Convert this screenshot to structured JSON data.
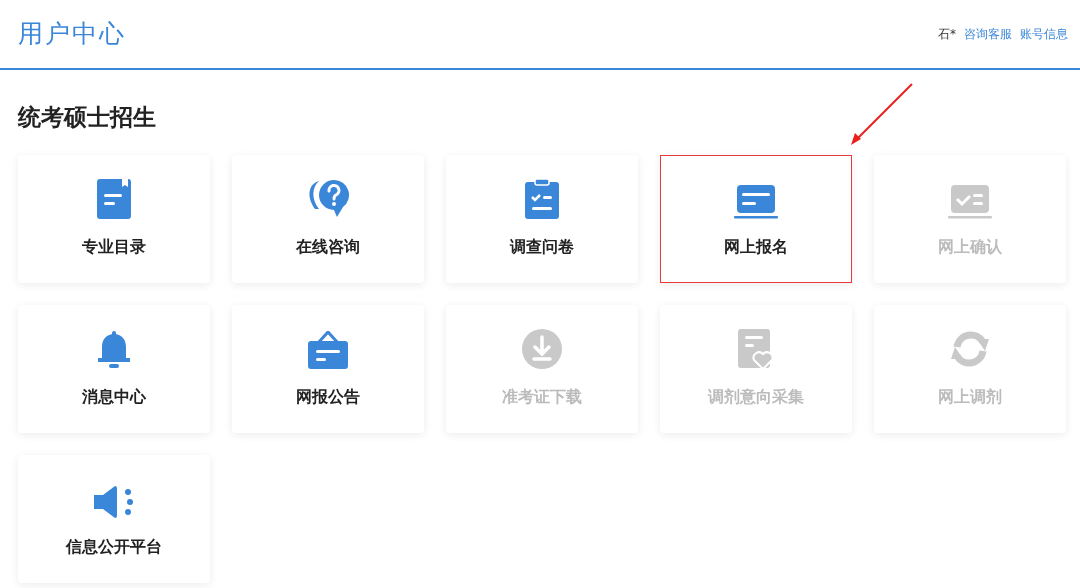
{
  "header": {
    "title": "用户中心",
    "user": "石*",
    "links": [
      {
        "label": "咨询客服"
      },
      {
        "label": "账号信息"
      }
    ]
  },
  "section": {
    "title": "统考硕士招生"
  },
  "tiles": [
    {
      "label": "专业目录",
      "enabled": true,
      "highlighted": false
    },
    {
      "label": "在线咨询",
      "enabled": true,
      "highlighted": false
    },
    {
      "label": "调查问卷",
      "enabled": true,
      "highlighted": false
    },
    {
      "label": "网上报名",
      "enabled": true,
      "highlighted": true
    },
    {
      "label": "网上确认",
      "enabled": false,
      "highlighted": false
    },
    {
      "label": "消息中心",
      "enabled": true,
      "highlighted": false
    },
    {
      "label": "网报公告",
      "enabled": true,
      "highlighted": false
    },
    {
      "label": "准考证下载",
      "enabled": false,
      "highlighted": false
    },
    {
      "label": "调剂意向采集",
      "enabled": false,
      "highlighted": false
    },
    {
      "label": "网上调剂",
      "enabled": false,
      "highlighted": false
    },
    {
      "label": "信息公开平台",
      "enabled": true,
      "highlighted": false
    }
  ]
}
